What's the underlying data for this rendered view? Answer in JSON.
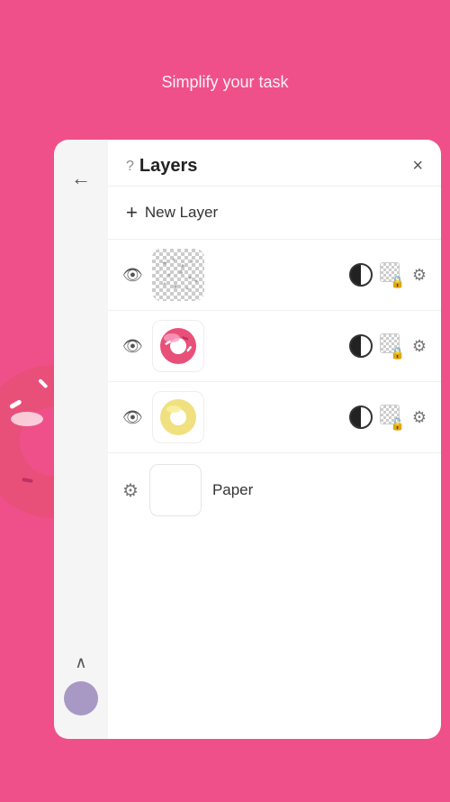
{
  "header": {
    "title": "Layers",
    "subtitle": "Simplify your task"
  },
  "panel": {
    "title": "Layers",
    "help_icon": "?",
    "close_label": "×",
    "new_layer_label": "New Layer"
  },
  "layers": [
    {
      "id": "layer-1",
      "type": "sketch",
      "visible": true
    },
    {
      "id": "layer-2",
      "type": "donut-pink",
      "visible": true
    },
    {
      "id": "layer-3",
      "type": "donut-yellow",
      "visible": true
    },
    {
      "id": "layer-paper",
      "type": "paper",
      "label": "Paper",
      "visible": true
    }
  ],
  "sidebar": {
    "back_label": "←",
    "chevron_label": "∧"
  }
}
